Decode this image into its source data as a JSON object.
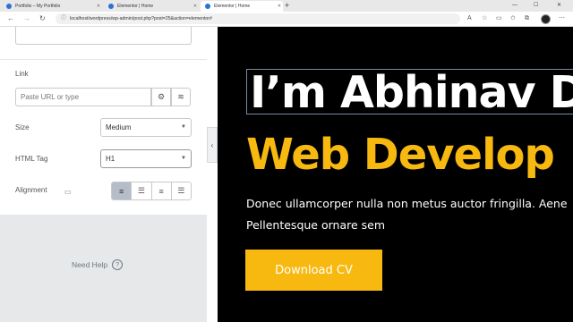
{
  "browser": {
    "tabs": [
      {
        "title": "Portfolio – My Portfolio",
        "active": false
      },
      {
        "title": "Elementor | Home",
        "active": false
      },
      {
        "title": "Elementor | Home",
        "active": true
      }
    ],
    "new_tab": "+",
    "window_controls": {
      "minimize": "—",
      "maximize": "☐",
      "close": "✕"
    },
    "nav": {
      "back": "←",
      "forward": "→",
      "reload": "↻"
    },
    "url": "localhost/wordpress/wp-admin/post.php?post=25&action=elementor#"
  },
  "panel": {
    "link": {
      "label": "Link",
      "placeholder": "Paste URL or type",
      "settings_icon": "gear-icon",
      "dynamic_icon": "database-icon"
    },
    "size": {
      "label": "Size",
      "value": "Medium"
    },
    "html_tag": {
      "label": "HTML Tag",
      "value": "H1"
    },
    "alignment": {
      "label": "Alignment",
      "device_icon": "desktop-icon",
      "options": [
        "align-left",
        "align-center",
        "align-right",
        "align-justify"
      ],
      "active": "align-left"
    },
    "help": {
      "label": "Need Help",
      "icon": "?"
    }
  },
  "preview": {
    "heading": "I’m Abhinav D",
    "subheading": "Web Develop",
    "paragraph": "Donec ullamcorper nulla non metus auctor fringilla. Aene Pellentesque ornare sem",
    "button": "Download CV",
    "colors": {
      "background": "#000000",
      "accent": "#f7b90f",
      "text": "#ffffff"
    }
  }
}
